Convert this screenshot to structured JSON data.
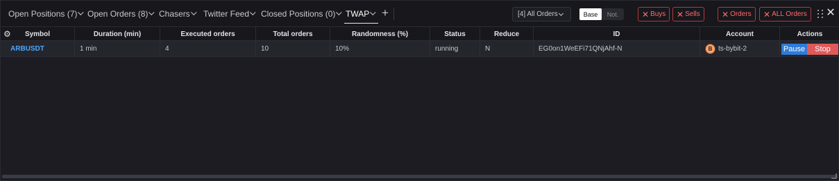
{
  "tabs": [
    {
      "label": "Open Positions (7)"
    },
    {
      "label": "Open Orders (8)"
    },
    {
      "label": "Chasers"
    },
    {
      "label": "Twitter Feed"
    },
    {
      "label": "Closed Positions (0)"
    },
    {
      "label": "TWAP"
    }
  ],
  "add_tab_label": "+",
  "filter_select": {
    "value": "[4] All Orders"
  },
  "toggle": {
    "base": "Base",
    "not": "Not.",
    "selected": "Base"
  },
  "actions": {
    "close_buys": "Buys",
    "close_sells": "Sells",
    "cancel_orders": "Orders",
    "cancel_all_orders": "ALL Orders",
    "close_symbol": "✕"
  },
  "table": {
    "columns": [
      "Symbol",
      "Duration (min)",
      "Executed orders",
      "Total orders",
      "Randomness (%)",
      "Status",
      "Reduce",
      "ID",
      "Account",
      "Actions"
    ],
    "rows": [
      {
        "symbol": "ARBUSDT",
        "duration": "1 min",
        "executed": "4",
        "total": "10",
        "randomness": "10%",
        "status": "running",
        "reduce": "N",
        "id": "EG0on1WeEFi71QNjAhf-N",
        "account": "ts-bybit-2",
        "account_icon_letter": "B",
        "pause_label": "Pause",
        "stop_label": "Stop"
      }
    ]
  },
  "colors": {
    "accent_blue": "#4da6ff",
    "danger_red": "#ff6b6b",
    "pause_blue": "#2f7bd8",
    "stop_red": "#e05a5a"
  }
}
